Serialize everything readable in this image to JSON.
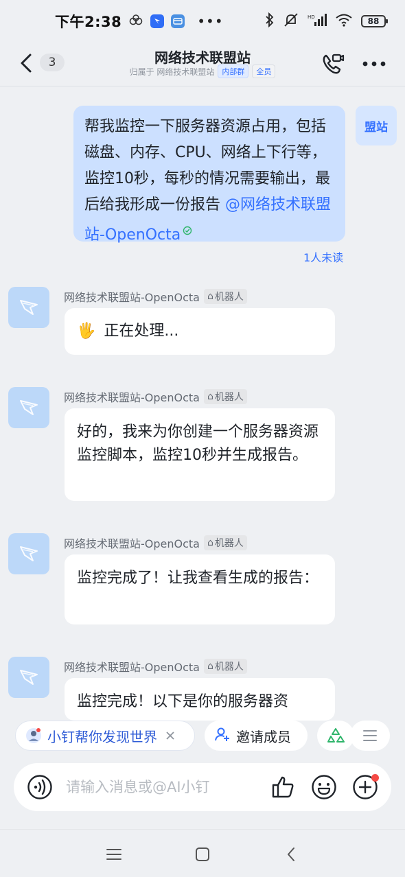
{
  "status_bar": {
    "time": "下午2:38",
    "battery": "88"
  },
  "header": {
    "unread_count": "3",
    "title": "网络技术联盟站",
    "subtitle_prefix": "归属于 网络技术联盟站",
    "tag_internal": "内部群",
    "tag_all": "全员"
  },
  "messages": {
    "my_message": {
      "text": "帮我监控一下服务器资源占用，包括磁盘、内存、CPU、网络上下行等，监控10秒，每秒的情况需要输出，最后给我形成一份报告",
      "mention": "@网络技术联盟站-OpenOcta",
      "read_status": "1人未读",
      "avatar_label": "盟站"
    },
    "bot": {
      "name": "网络技术联盟站-OpenOcta",
      "tag": "机器人"
    },
    "bot_messages": [
      {
        "emoji": "🖐",
        "text": "正在处理..."
      },
      {
        "text": "好的，我来为你创建一个服务器资源监控脚本，监控10秒并生成报告。"
      },
      {
        "text": "监控完成了！让我查看生成的报告："
      },
      {
        "text": "监控完成！以下是你的服务器资"
      }
    ]
  },
  "bottom": {
    "ai_chip": "小钉帮你发现世界",
    "invite_chip": "邀请成员",
    "input_placeholder": "请输入消息或@AI小钉"
  },
  "icons": {
    "accent_color": "#3370ff",
    "bubble_color": "#cce0ff"
  }
}
